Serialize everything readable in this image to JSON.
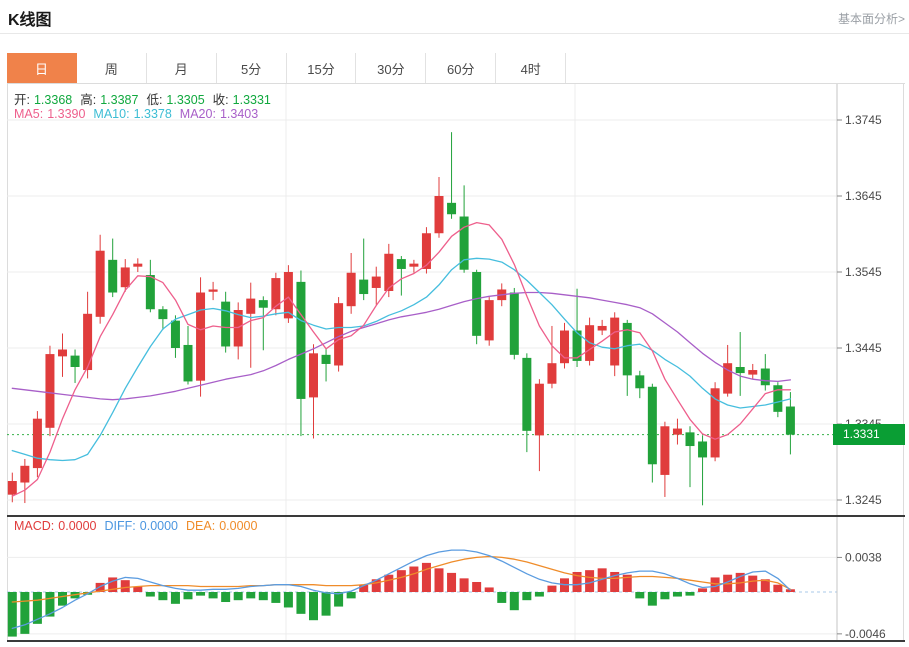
{
  "header": {
    "title": "K线图",
    "link": "基本面分析>"
  },
  "tabs": {
    "items": [
      "日",
      "周",
      "月",
      "5分",
      "15分",
      "30分",
      "60分",
      "4时"
    ],
    "selected_index": 0
  },
  "legend": {
    "ohlc": [
      {
        "label": "开:",
        "value": "1.3368"
      },
      {
        "label": "高:",
        "value": "1.3387"
      },
      {
        "label": "低:",
        "value": "1.3305"
      },
      {
        "label": "收:",
        "value": "1.3331"
      }
    ],
    "ma": [
      {
        "label": "MA5:",
        "value": "1.3390",
        "color": "#ee5f8c"
      },
      {
        "label": "MA10:",
        "value": "1.3378",
        "color": "#3cbdd4"
      },
      {
        "label": "MA20:",
        "value": "1.3403",
        "color": "#a85fc8"
      }
    ],
    "macd": [
      {
        "label": "MACD:",
        "value": "0.0000",
        "color": "#e03c3c"
      },
      {
        "label": "DIFF:",
        "value": "0.0000",
        "color": "#4b96e0"
      },
      {
        "label": "DEA:",
        "value": "0.0000",
        "color": "#ef8c2a"
      }
    ]
  },
  "chart_data": {
    "type": "candlestick+macd",
    "price_axis": {
      "ticks": [
        "1.3745",
        "1.3645",
        "1.3545",
        "1.3445",
        "1.3345",
        "1.3245"
      ],
      "current_price": "1.3331"
    },
    "macd_axis": {
      "ticks": [
        "0.0038",
        "-0.0046"
      ]
    },
    "colors": {
      "up": "#e03c3c",
      "down": "#21a23a",
      "ma5": "#ee5f8c",
      "ma10": "#46bede",
      "ma20": "#a85fc8",
      "diff": "#5b9ce0",
      "dea": "#ef8c2a",
      "price_tag": "#0a9e34",
      "dotted_line": "#35b14a",
      "tab_accent": "#f0824a",
      "value_green": "#10a83e"
    },
    "candles": [
      [
        1.3252,
        1.3281,
        1.3242,
        1.327
      ],
      [
        1.3268,
        1.3299,
        1.3241,
        1.329
      ],
      [
        1.3287,
        1.3362,
        1.3275,
        1.3352
      ],
      [
        1.334,
        1.3448,
        1.3329,
        1.3437
      ],
      [
        1.3434,
        1.3464,
        1.3407,
        1.3443
      ],
      [
        1.3435,
        1.3443,
        1.3399,
        1.342
      ],
      [
        1.3416,
        1.3519,
        1.3405,
        1.349
      ],
      [
        1.3486,
        1.3594,
        1.3477,
        1.3573
      ],
      [
        1.3561,
        1.3589,
        1.3512,
        1.3518
      ],
      [
        1.3525,
        1.3562,
        1.3519,
        1.3551
      ],
      [
        1.3552,
        1.3563,
        1.3545,
        1.3556
      ],
      [
        1.3541,
        1.3561,
        1.3492,
        1.3496
      ],
      [
        1.3496,
        1.35,
        1.3469,
        1.3483
      ],
      [
        1.3481,
        1.3488,
        1.3432,
        1.3445
      ],
      [
        1.3449,
        1.3474,
        1.3397,
        1.3401
      ],
      [
        1.3402,
        1.3538,
        1.3381,
        1.3518
      ],
      [
        1.3519,
        1.3532,
        1.3508,
        1.3522
      ],
      [
        1.3506,
        1.3519,
        1.3439,
        1.3447
      ],
      [
        1.3447,
        1.3505,
        1.343,
        1.3495
      ],
      [
        1.349,
        1.3531,
        1.3419,
        1.351
      ],
      [
        1.3508,
        1.3513,
        1.3442,
        1.3498
      ],
      [
        1.3496,
        1.3544,
        1.3488,
        1.3537
      ],
      [
        1.3484,
        1.3554,
        1.3478,
        1.3545
      ],
      [
        1.3532,
        1.3547,
        1.3329,
        1.3378
      ],
      [
        1.338,
        1.345,
        1.3326,
        1.3438
      ],
      [
        1.3436,
        1.3444,
        1.3401,
        1.3424
      ],
      [
        1.3422,
        1.3512,
        1.3414,
        1.3504
      ],
      [
        1.35,
        1.357,
        1.349,
        1.3544
      ],
      [
        1.3535,
        1.3589,
        1.3508,
        1.3516
      ],
      [
        1.3524,
        1.3552,
        1.3502,
        1.3539
      ],
      [
        1.352,
        1.3582,
        1.3512,
        1.3569
      ],
      [
        1.3562,
        1.3566,
        1.3514,
        1.3549
      ],
      [
        1.3552,
        1.3561,
        1.3544,
        1.3556
      ],
      [
        1.3549,
        1.3604,
        1.3543,
        1.3596
      ],
      [
        1.3596,
        1.367,
        1.359,
        1.3645
      ],
      [
        1.3636,
        1.3729,
        1.3615,
        1.3621
      ],
      [
        1.3618,
        1.3659,
        1.3544,
        1.3548
      ],
      [
        1.3545,
        1.3548,
        1.345,
        1.3461
      ],
      [
        1.3455,
        1.3512,
        1.3448,
        1.3508
      ],
      [
        1.3508,
        1.353,
        1.35,
        1.3522
      ],
      [
        1.3518,
        1.3524,
        1.343,
        1.3436
      ],
      [
        1.3432,
        1.3438,
        1.3308,
        1.3336
      ],
      [
        1.333,
        1.3404,
        1.3283,
        1.3398
      ],
      [
        1.3398,
        1.3474,
        1.3392,
        1.3425
      ],
      [
        1.3425,
        1.3478,
        1.3418,
        1.3468
      ],
      [
        1.3468,
        1.3523,
        1.342,
        1.3428
      ],
      [
        1.3428,
        1.3485,
        1.3422,
        1.3475
      ],
      [
        1.3468,
        1.3482,
        1.3462,
        1.3474
      ],
      [
        1.3422,
        1.3492,
        1.3408,
        1.3485
      ],
      [
        1.3478,
        1.3482,
        1.3382,
        1.3409
      ],
      [
        1.3409,
        1.3415,
        1.3379,
        1.3392
      ],
      [
        1.3394,
        1.3398,
        1.3268,
        1.3292
      ],
      [
        1.3278,
        1.3348,
        1.3249,
        1.3342
      ],
      [
        1.3331,
        1.3352,
        1.3318,
        1.3339
      ],
      [
        1.3334,
        1.3342,
        1.3262,
        1.3316
      ],
      [
        1.3322,
        1.333,
        1.3238,
        1.3301
      ],
      [
        1.3301,
        1.34,
        1.3296,
        1.3392
      ],
      [
        1.3385,
        1.3449,
        1.3381,
        1.3425
      ],
      [
        1.342,
        1.3466,
        1.3382,
        1.3412
      ],
      [
        1.341,
        1.3424,
        1.3404,
        1.3416
      ],
      [
        1.3418,
        1.3437,
        1.3389,
        1.3396
      ],
      [
        1.3396,
        1.34,
        1.3354,
        1.3361
      ],
      [
        1.3368,
        1.3387,
        1.3305,
        1.3331
      ]
    ],
    "ma5": [
      1.325,
      1.3258,
      1.3272,
      1.3308,
      1.3352,
      1.339,
      1.342,
      1.346,
      1.3489,
      1.3521,
      1.354,
      1.3539,
      1.3531,
      1.3508,
      1.3476,
      1.3469,
      1.3474,
      1.3472,
      1.3472,
      1.3481,
      1.3485,
      1.35,
      1.3512,
      1.3489,
      1.3466,
      1.3444,
      1.3456,
      1.3461,
      1.3475,
      1.3501,
      1.3524,
      1.3536,
      1.3543,
      1.3554,
      1.3571,
      1.3592,
      1.3604,
      1.361,
      1.3607,
      1.3588,
      1.3555,
      1.3513,
      1.3474,
      1.3448,
      1.3432,
      1.3432,
      1.3443,
      1.3454,
      1.3466,
      1.3469,
      1.3465,
      1.3441,
      1.3404,
      1.3377,
      1.3351,
      1.3332,
      1.3325,
      1.3331,
      1.3345,
      1.3365,
      1.3385,
      1.339,
      1.339
    ],
    "ma10": [
      1.331,
      1.3305,
      1.33,
      1.3298,
      1.3297,
      1.3298,
      1.3305,
      1.333,
      1.336,
      1.3392,
      1.342,
      1.3447,
      1.347,
      1.3483,
      1.3489,
      1.3495,
      1.3497,
      1.3494,
      1.3489,
      1.3485,
      1.3487,
      1.349,
      1.3492,
      1.3481,
      1.3475,
      1.347,
      1.3472,
      1.3472,
      1.3474,
      1.348,
      1.3488,
      1.3494,
      1.3502,
      1.3512,
      1.3528,
      1.3548,
      1.3561,
      1.3563,
      1.3562,
      1.3558,
      1.3548,
      1.3534,
      1.3518,
      1.3502,
      1.3483,
      1.3465,
      1.3452,
      1.3446,
      1.3444,
      1.3448,
      1.345,
      1.3442,
      1.343,
      1.342,
      1.3408,
      1.3392,
      1.3378,
      1.337,
      1.3366,
      1.3368,
      1.337,
      1.3374,
      1.3378
    ],
    "ma20": [
      1.3392,
      1.339,
      1.3388,
      1.3386,
      1.3384,
      1.3382,
      1.338,
      1.3378,
      1.3377,
      1.3378,
      1.338,
      1.3382,
      1.3385,
      1.3388,
      1.3392,
      1.3396,
      1.34,
      1.3404,
      1.3407,
      1.341,
      1.3415,
      1.3422,
      1.343,
      1.3437,
      1.3444,
      1.3452,
      1.346,
      1.3467,
      1.3472,
      1.3477,
      1.3482,
      1.3486,
      1.3489,
      1.3492,
      1.3496,
      1.3501,
      1.3506,
      1.351,
      1.3513,
      1.3515,
      1.3517,
      1.3518,
      1.3518,
      1.3517,
      1.3515,
      1.3513,
      1.3511,
      1.3508,
      1.3505,
      1.3502,
      1.3498,
      1.349,
      1.3478,
      1.3466,
      1.3452,
      1.3438,
      1.3426,
      1.3416,
      1.3408,
      1.3404,
      1.3402,
      1.3401,
      1.3403
    ],
    "macd_hist": [
      -0.0049,
      -0.0046,
      -0.0035,
      -0.0027,
      -0.0015,
      -0.0007,
      -0.0003,
      0.001,
      0.0016,
      0.0013,
      0.0006,
      -0.0005,
      -0.0009,
      -0.0013,
      -0.0008,
      -0.0004,
      -0.0007,
      -0.0011,
      -0.0009,
      -0.0007,
      -0.0009,
      -0.0012,
      -0.0017,
      -0.0024,
      -0.0031,
      -0.0026,
      -0.0016,
      -0.0007,
      0.0008,
      0.0014,
      0.0019,
      0.0024,
      0.0028,
      0.0032,
      0.0026,
      0.0021,
      0.0015,
      0.0011,
      0.0005,
      -0.0012,
      -0.002,
      -0.0009,
      -0.0005,
      0.0007,
      0.0015,
      0.0022,
      0.0024,
      0.0026,
      0.0022,
      0.0019,
      -0.0007,
      -0.0015,
      -0.0008,
      -0.0005,
      -0.0004,
      0.0004,
      0.0016,
      0.0019,
      0.0021,
      0.0018,
      0.0014,
      0.0008,
      0.0003
    ],
    "diff": [
      -0.004,
      -0.0036,
      -0.003,
      -0.0024,
      -0.0017,
      -0.0009,
      -0.0002,
      0.0006,
      0.0012,
      0.0016,
      0.0015,
      0.0011,
      0.0007,
      0.0004,
      0.0002,
      0.0002,
      0.0003,
      0.0003,
      0.0004,
      0.0006,
      0.0007,
      0.0008,
      0.0008,
      0.0006,
      0.0002,
      -0.0001,
      -0.0002,
      0.0001,
      0.0007,
      0.0013,
      0.002,
      0.0027,
      0.0034,
      0.004,
      0.0044,
      0.0046,
      0.0046,
      0.0044,
      0.004,
      0.0034,
      0.0027,
      0.002,
      0.0014,
      0.001,
      0.0008,
      0.0008,
      0.001,
      0.0014,
      0.0018,
      0.0021,
      0.0023,
      0.0023,
      0.002,
      0.0015,
      0.0009,
      0.0005,
      0.0006,
      0.0011,
      0.0017,
      0.0022,
      0.0023,
      0.0015,
      0.0002
    ],
    "dea": [
      -0.0011,
      -0.001,
      -0.0009,
      -0.0007,
      -0.0005,
      -0.0003,
      -0.0001,
      0.0001,
      0.0003,
      0.0005,
      0.0006,
      0.0007,
      0.0007,
      0.0007,
      0.0007,
      0.0006,
      0.0006,
      0.0006,
      0.0006,
      0.0007,
      0.0007,
      0.0008,
      0.0008,
      0.0008,
      0.0008,
      0.0007,
      0.0007,
      0.0007,
      0.0008,
      0.001,
      0.0013,
      0.0016,
      0.002,
      0.0025,
      0.0029,
      0.0033,
      0.0036,
      0.0038,
      0.0039,
      0.0038,
      0.0036,
      0.0033,
      0.0029,
      0.0025,
      0.0021,
      0.0018,
      0.0016,
      0.0015,
      0.0015,
      0.0016,
      0.0017,
      0.0017,
      0.0016,
      0.0015,
      0.0013,
      0.0011,
      0.0009,
      0.0009,
      0.001,
      0.0012,
      0.0013,
      0.001,
      0.0003
    ]
  }
}
